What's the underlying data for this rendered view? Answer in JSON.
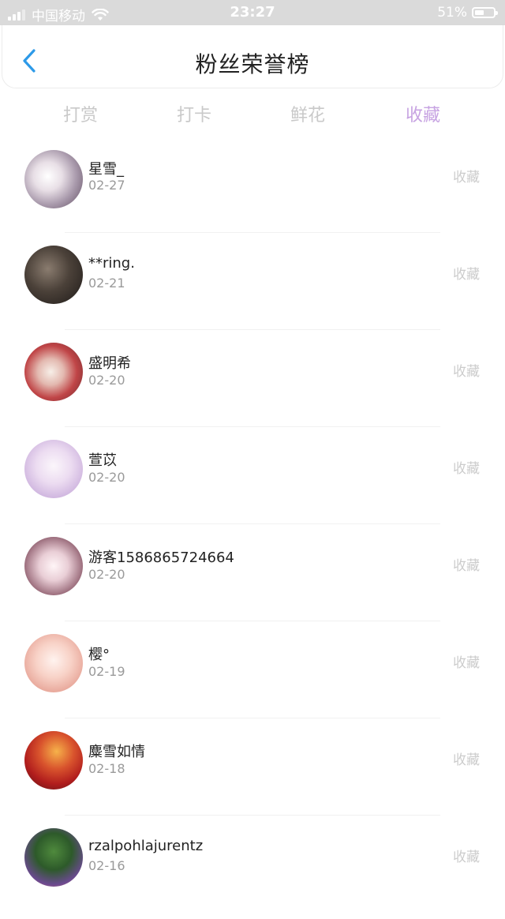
{
  "status_bar": {
    "carrier": "中国移动",
    "time": "23:27",
    "battery": "51%",
    "battery_level": 0.51
  },
  "header": {
    "title": "粉丝荣誉榜",
    "back_icon": "chevron-left-icon"
  },
  "tabs": [
    {
      "label": "打赏",
      "active": false
    },
    {
      "label": "打卡",
      "active": false
    },
    {
      "label": "鲜花",
      "active": false
    },
    {
      "label": "收藏",
      "active": true
    }
  ],
  "colors": {
    "accent": "#c7a3e2",
    "back_arrow": "#2d9ae8",
    "muted_text": "#cccccc"
  },
  "fans": [
    {
      "name": "星雪_",
      "date": "02-27",
      "action": "收藏"
    },
    {
      "name": "**ring.",
      "date": "02-21",
      "action": "收藏"
    },
    {
      "name": "盛明希",
      "date": "02-20",
      "action": "收藏"
    },
    {
      "name": "萱苡",
      "date": "02-20",
      "action": "收藏"
    },
    {
      "name": "游客1586865724664",
      "date": "02-20",
      "action": "收藏"
    },
    {
      "name": "樱°",
      "date": "02-19",
      "action": "收藏"
    },
    {
      "name": "麋雪如情",
      "date": "02-18",
      "action": "收藏"
    },
    {
      "name": "rzalpohlajurentz",
      "date": "02-16",
      "action": "收藏"
    }
  ]
}
